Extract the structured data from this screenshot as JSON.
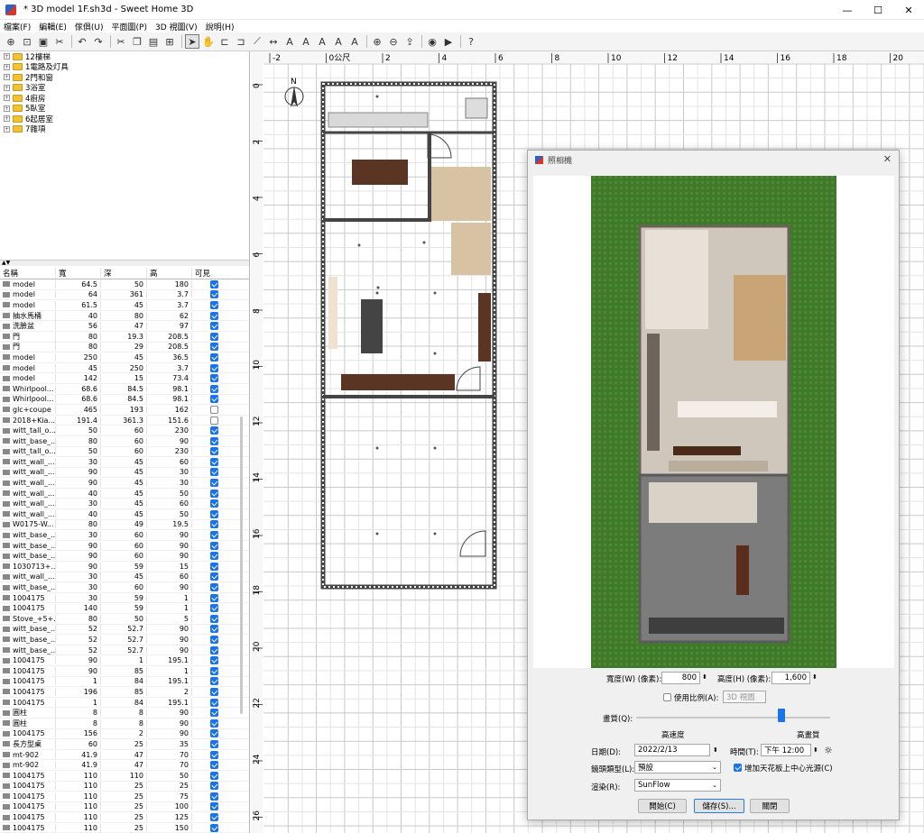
{
  "window": {
    "title": "* 3D model 1F.sh3d - Sweet Home 3D",
    "minimize": "—",
    "maximize": "☐",
    "close": "✕"
  },
  "menu": [
    "檔案(F)",
    "編輯(E)",
    "傢俱(U)",
    "平面圖(P)",
    "3D 視圖(V)",
    "說明(H)"
  ],
  "toolbar": [
    "new-icon",
    "open-icon",
    "save-icon",
    "cut-icon",
    "undo-icon",
    "redo-icon",
    "cut2-icon",
    "copy-icon",
    "paste-icon",
    "add-furniture-icon",
    "select-icon",
    "pan-icon",
    "create-walls-icon",
    "create-rooms-icon",
    "create-polylines-icon",
    "create-dimensions-icon",
    "add-text-icon",
    "text-style-icon",
    "text-size-icon",
    "bold-icon",
    "italic-icon",
    "zoom-in-icon",
    "zoom-out-icon",
    "import-icon",
    "photo-icon",
    "video-icon",
    "help-icon"
  ],
  "tree": [
    "12樓梯",
    "1電路及灯具",
    "2門和窗",
    "3浴室",
    "4廚房",
    "5臥室",
    "6起居室",
    "7雜項"
  ],
  "furniture": {
    "headers": [
      "名稱",
      "寬",
      "深",
      "高",
      "可見"
    ],
    "rows": [
      [
        "model",
        "64.5",
        "50",
        "180",
        1
      ],
      [
        "model",
        "64",
        "361",
        "3.7",
        1
      ],
      [
        "model",
        "61.5",
        "45",
        "3.7",
        1
      ],
      [
        "抽水馬桶",
        "40",
        "80",
        "62",
        1
      ],
      [
        "洗臉盆",
        "56",
        "47",
        "97",
        1
      ],
      [
        "門",
        "80",
        "19.3",
        "208.5",
        1
      ],
      [
        "門",
        "80",
        "29",
        "208.5",
        1
      ],
      [
        "model",
        "250",
        "45",
        "36.5",
        1
      ],
      [
        "model",
        "45",
        "250",
        "3.7",
        1
      ],
      [
        "model",
        "142",
        "15",
        "73.4",
        1
      ],
      [
        "Whirlpool...",
        "68.6",
        "84.5",
        "98.1",
        1
      ],
      [
        "Whirlpool...",
        "68.6",
        "84.5",
        "98.1",
        1
      ],
      [
        "glc+coupe",
        "465",
        "193",
        "162",
        0
      ],
      [
        "2018+Kia...",
        "191.4",
        "361.3",
        "151.6",
        0
      ],
      [
        "witt_tall_o...",
        "50",
        "60",
        "230",
        1
      ],
      [
        "witt_base_...",
        "80",
        "60",
        "90",
        1
      ],
      [
        "witt_tall_o...",
        "50",
        "60",
        "230",
        1
      ],
      [
        "witt_wall_...",
        "30",
        "45",
        "60",
        1
      ],
      [
        "witt_wall_...",
        "90",
        "45",
        "30",
        1
      ],
      [
        "witt_wall_...",
        "90",
        "45",
        "30",
        1
      ],
      [
        "witt_wall_...",
        "40",
        "45",
        "50",
        1
      ],
      [
        "witt_wall_...",
        "30",
        "45",
        "60",
        1
      ],
      [
        "witt_wall_...",
        "40",
        "45",
        "50",
        1
      ],
      [
        "W0175-W...",
        "80",
        "49",
        "19.5",
        1
      ],
      [
        "witt_base_...",
        "30",
        "60",
        "90",
        1
      ],
      [
        "witt_base_...",
        "90",
        "60",
        "90",
        1
      ],
      [
        "witt_base_...",
        "90",
        "60",
        "90",
        1
      ],
      [
        "1030713+...",
        "90",
        "59",
        "15",
        1
      ],
      [
        "witt_wall_...",
        "30",
        "45",
        "60",
        1
      ],
      [
        "witt_base_...",
        "30",
        "60",
        "90",
        1
      ],
      [
        "1004175",
        "30",
        "59",
        "1",
        1
      ],
      [
        "1004175",
        "140",
        "59",
        "1",
        1
      ],
      [
        "Stove_+5+...",
        "80",
        "50",
        "5",
        1
      ],
      [
        "witt_base_...",
        "52",
        "52.7",
        "90",
        1
      ],
      [
        "witt_base_...",
        "52",
        "52.7",
        "90",
        1
      ],
      [
        "witt_base_...",
        "52",
        "52.7",
        "90",
        1
      ],
      [
        "1004175",
        "90",
        "1",
        "195.1",
        1
      ],
      [
        "1004175",
        "90",
        "85",
        "1",
        1
      ],
      [
        "1004175",
        "1",
        "84",
        "195.1",
        1
      ],
      [
        "1004175",
        "196",
        "85",
        "2",
        1
      ],
      [
        "1004175",
        "1",
        "84",
        "195.1",
        1
      ],
      [
        "圓柱",
        "8",
        "8",
        "90",
        1
      ],
      [
        "圓柱",
        "8",
        "8",
        "90",
        1
      ],
      [
        "1004175",
        "156",
        "2",
        "90",
        1
      ],
      [
        "長方型桌",
        "60",
        "25",
        "35",
        1
      ],
      [
        "mt-902",
        "41.9",
        "47",
        "70",
        1
      ],
      [
        "mt-902",
        "41.9",
        "47",
        "70",
        1
      ],
      [
        "1004175",
        "110",
        "110",
        "50",
        1
      ],
      [
        "1004175",
        "110",
        "25",
        "25",
        1
      ],
      [
        "1004175",
        "110",
        "25",
        "75",
        1
      ],
      [
        "1004175",
        "110",
        "25",
        "100",
        1
      ],
      [
        "1004175",
        "110",
        "25",
        "125",
        1
      ],
      [
        "1004175",
        "110",
        "25",
        "150",
        1
      ]
    ]
  },
  "plan": {
    "rulerx": [
      "-2",
      "0公尺",
      "2",
      "4",
      "6",
      "8",
      "10",
      "12",
      "14",
      "16",
      "18",
      "20"
    ],
    "rulery": [
      "0",
      "2",
      "4",
      "6",
      "8",
      "10",
      "12",
      "14",
      "16",
      "18",
      "20",
      "22",
      "24",
      "26"
    ],
    "compass": "N"
  },
  "dialog": {
    "title": "照相機",
    "close": "✕",
    "width_label": "寬度(W) (像素):",
    "width_value": "800",
    "height_label": "高度(H) (像素):",
    "height_value": "1,600",
    "ratio_label": "使用比例(A):",
    "ratio_value": "3D 視圖",
    "quality_label": "畫質(Q):",
    "quality_fast": "高速度",
    "quality_best": "高畫質",
    "quality_level": 0.75,
    "date_label": "日期(D):",
    "date_value": "2022/2/13",
    "time_label": "時間(T):",
    "time_value": "下午 12:00",
    "lens_label": "鏡頭類型(L):",
    "lens_value": "預設",
    "ceiling_label": "增加天花板上中心光源(C)",
    "render_label": "渲染(R):",
    "render_value": "SunFlow",
    "btn_start": "開始(C)",
    "btn_save": "儲存(S)...",
    "btn_close": "關閉"
  },
  "colors": {
    "accent": "#1a73e8",
    "grass": "#3f7a2a",
    "wall": "#555555"
  }
}
